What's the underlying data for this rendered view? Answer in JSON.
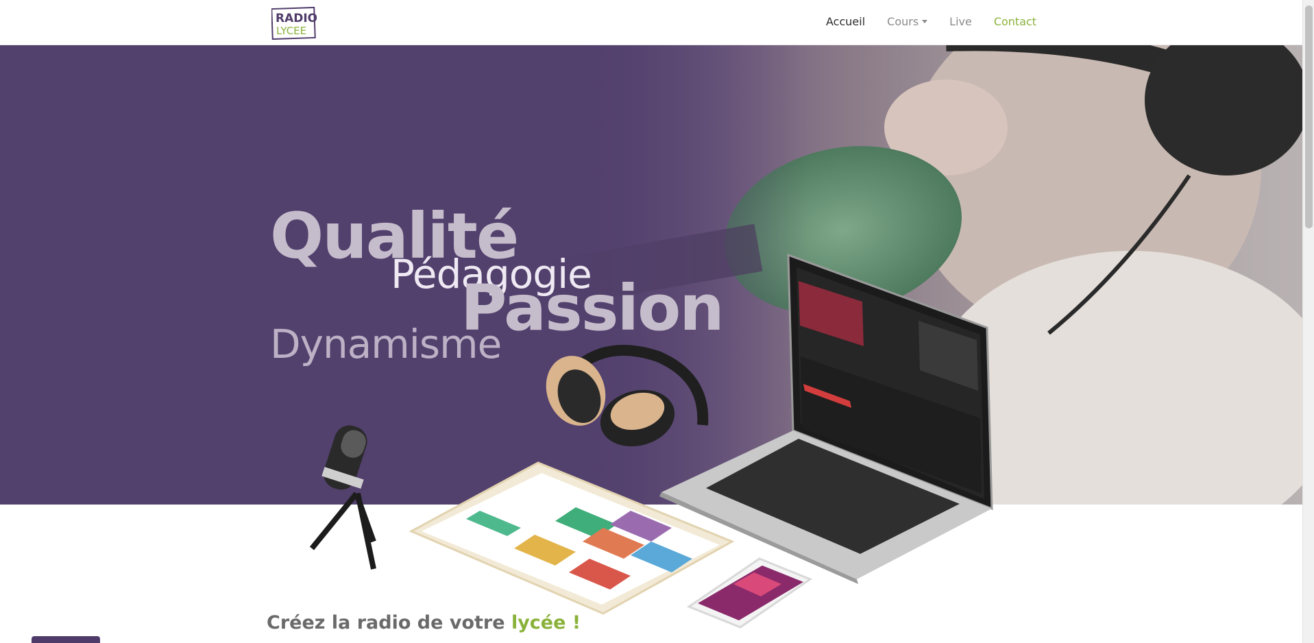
{
  "navbar": {
    "logo": {
      "line1": "RADIO",
      "line2": "LYCEE"
    },
    "items": [
      {
        "label": "Accueil",
        "state": "active"
      },
      {
        "label": "Cours",
        "state": "dropdown"
      },
      {
        "label": "Live",
        "state": "normal"
      },
      {
        "label": "Contact",
        "state": "highlight"
      }
    ]
  },
  "hero": {
    "words": {
      "qualite": "Qualité",
      "pedagogie": "Pédagogie",
      "passion": "Passion",
      "dynamisme": "Dynamisme"
    }
  },
  "headline": {
    "prefix": "Créez la radio de votre ",
    "accent": "lycée !"
  },
  "colors": {
    "brand_purple": "#4f3b6a",
    "accent_green": "#8ab23a",
    "text_dark": "#2b2b2b",
    "text_muted": "#8a8a8a"
  },
  "icons": [
    "radio-lycee-logo",
    "chevron-down-icon",
    "microphone-illustration",
    "headphones-illustration",
    "laptop-illustration",
    "tablet-illustration",
    "smartphone-illustration"
  ]
}
